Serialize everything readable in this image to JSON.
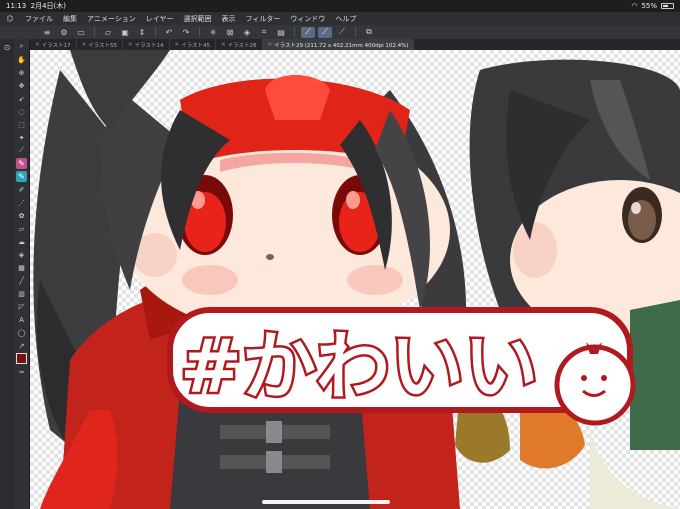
{
  "status": {
    "time": "11:13",
    "date": "2月4日(木)",
    "battery": "55%",
    "battery_level": 0.55
  },
  "menu": {
    "items": [
      "ファイル",
      "編集",
      "アニメーション",
      "レイヤー",
      "選択範囲",
      "表示",
      "フィルター",
      "ウィンドウ",
      "ヘルプ"
    ]
  },
  "tabs": [
    {
      "label": "イラスト17"
    },
    {
      "label": "イラスト55"
    },
    {
      "label": "イラスト14"
    },
    {
      "label": "イラスト45"
    },
    {
      "label": "イラスト28"
    },
    {
      "label": "イラスト29 (211.72 x 402.21mm 400dpi 102.4%)"
    }
  ],
  "canvas": {
    "sticker_text": "#かわいい"
  },
  "colors": {
    "main_color": "#7a0f12",
    "accent": "#5a6b87",
    "sticker_red": "#b0191e"
  },
  "icons": {
    "toolbar": [
      "menu-icon",
      "settings-icon",
      "file-icon",
      "open-icon",
      "save-icon",
      "undo-icon",
      "redo-icon",
      "spinner-icon",
      "transform-icon",
      "clear-icon",
      "fill-icon",
      "crop-icon",
      "ruler-icon",
      "pen-icon",
      "pen-edit-icon",
      "eyedropper-icon",
      "duplicate-icon"
    ]
  }
}
